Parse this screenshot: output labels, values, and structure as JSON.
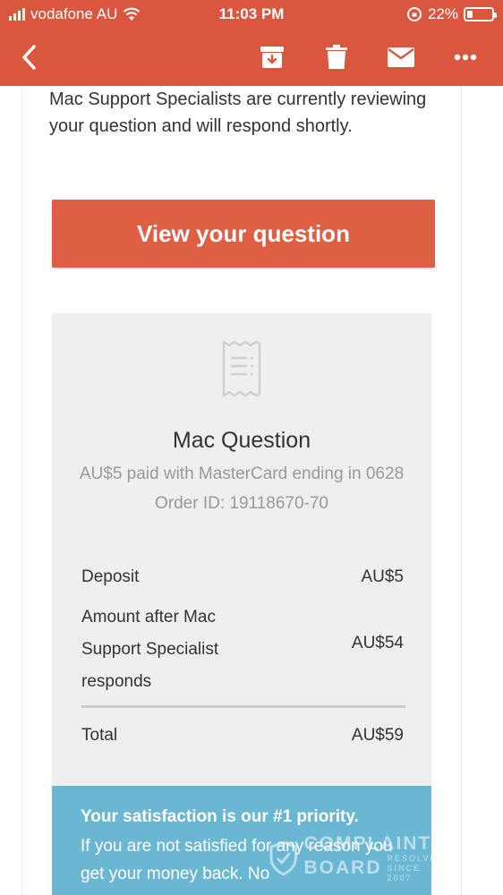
{
  "status_bar": {
    "carrier": "vodafone AU",
    "time": "11:03 PM",
    "battery": "22%"
  },
  "toolbar": {
    "back_icon": "chevron-left-icon",
    "archive_icon": "archive-icon",
    "delete_icon": "trash-icon",
    "mail_icon": "envelope-icon",
    "more_icon": "more-dots-icon",
    "color": "#d9573f"
  },
  "email": {
    "intro_text": "Mac Support Specialists are currently reviewing your question and will respond shortly.",
    "cta_label": "View your question",
    "cta_color": "#df5f45"
  },
  "receipt": {
    "icon": "receipt-icon",
    "title": "Mac Question",
    "payment_line": "AU$5 paid with MasterCard ending in 0628",
    "order_id": "Order ID: 19118670-70",
    "items": [
      {
        "label": "Deposit",
        "amount": "AU$5"
      },
      {
        "label": "Amount after Mac Support Specialist responds",
        "amount": "AU$54"
      }
    ],
    "total_label": "Total",
    "total_amount": "AU$59"
  },
  "banner": {
    "headline": "Your satisfaction is our #1 priority.",
    "body": "If you are not satisfied for any reason you get your money back. No",
    "color": "#6ab7d3"
  },
  "watermark": {
    "line1": "COMPLAINTS",
    "line2": "BOARD",
    "side1": "RESOLVED",
    "side2": "SINCE 2007"
  }
}
